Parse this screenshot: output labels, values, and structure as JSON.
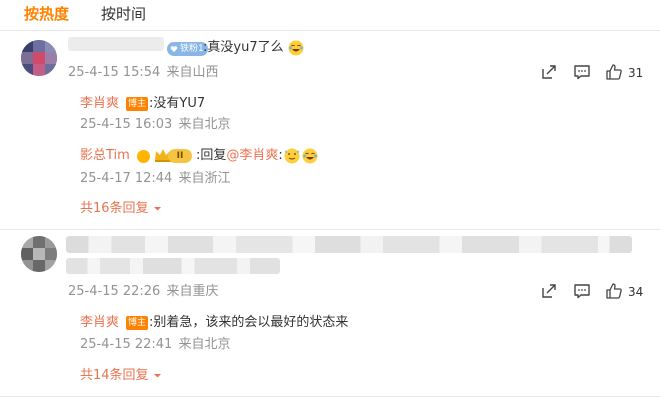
{
  "tabs": {
    "hot": "按热度",
    "time": "按时间"
  },
  "comments": [
    {
      "text": ":真没yu7了么",
      "fan_badge": "铁粉1",
      "time": "25-4-15 15:54",
      "location": "来自山西",
      "like_count": "31",
      "replies": [
        {
          "author": "李肖爽",
          "badge": "博主",
          "text": ":没有YU7",
          "time": "25-4-15 16:03",
          "location": "来自北京"
        },
        {
          "author": "影总Tim",
          "level_badge": "II",
          "text_prefix": ":回复",
          "mention": "@李肖爽",
          "text_suffix": ":",
          "time": "25-4-17 12:44",
          "location": "来自浙江"
        }
      ],
      "more_replies": "共16条回复"
    },
    {
      "time": "25-4-15 22:26",
      "location": "来自重庆",
      "like_count": "34",
      "replies": [
        {
          "author": "李肖爽",
          "badge": "博主",
          "text": ":别着急，该来的会以最好的状态来",
          "time": "25-4-15 22:41",
          "location": "来自北京"
        }
      ],
      "more_replies": "共14条回复"
    }
  ],
  "icons": {
    "share": "share-icon",
    "comment": "comment-icon",
    "like": "like-icon",
    "chevron": "chevron-down-icon",
    "emoji": "laughing-emoji-icon"
  },
  "colors": {
    "accent": "#ff8200",
    "link": "#eb7350",
    "meta": "#939393",
    "fan_badge": "#88b6e6"
  }
}
